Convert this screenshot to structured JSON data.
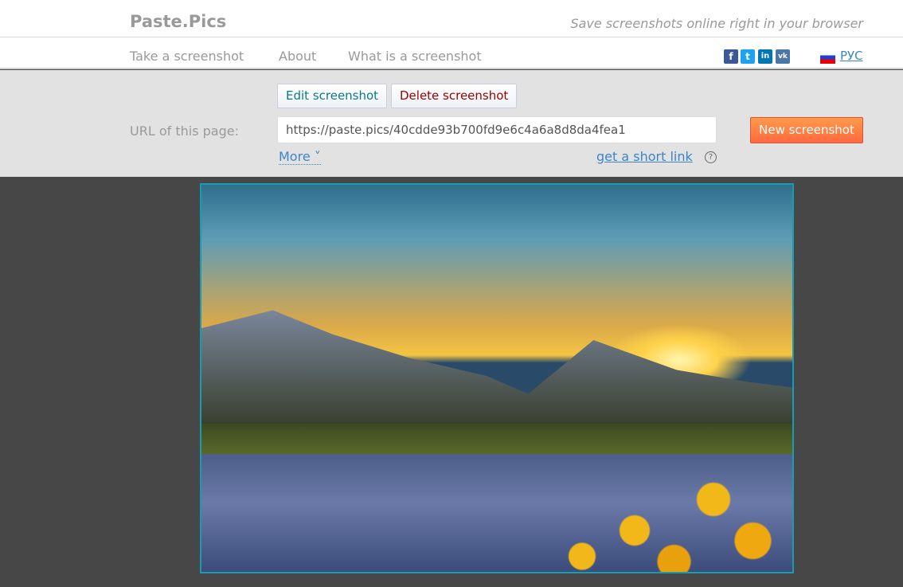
{
  "header": {
    "logo": "Paste.Pics",
    "tagline": "Save screenshots online right in your browser"
  },
  "nav": {
    "items": [
      "Take a screenshot",
      "About",
      "What is a screenshot"
    ],
    "social": [
      {
        "name": "facebook",
        "glyph": "f",
        "color": "#3b5998"
      },
      {
        "name": "twitter",
        "glyph": "t",
        "color": "#1da1f2"
      },
      {
        "name": "linkedin",
        "glyph": "in",
        "color": "#0077b5"
      },
      {
        "name": "vk",
        "glyph": "vk",
        "color": "#4a76a8"
      }
    ],
    "language": "РУС"
  },
  "panel": {
    "edit_label": "Edit screenshot",
    "delete_label": "Delete screenshot",
    "url_label": "URL of this page:",
    "url_value": "https://paste.pics/40cdde93b700fd9e6c4a6a8d8da4fea1",
    "new_label": "New screenshot",
    "more_label": "More ˅",
    "short_link_label": "get a short link",
    "help": "?"
  },
  "colors": {
    "accent": "#ff7a44",
    "link": "#3a86c8",
    "edit": "#0a7a8a",
    "delete": "#9a0000"
  }
}
